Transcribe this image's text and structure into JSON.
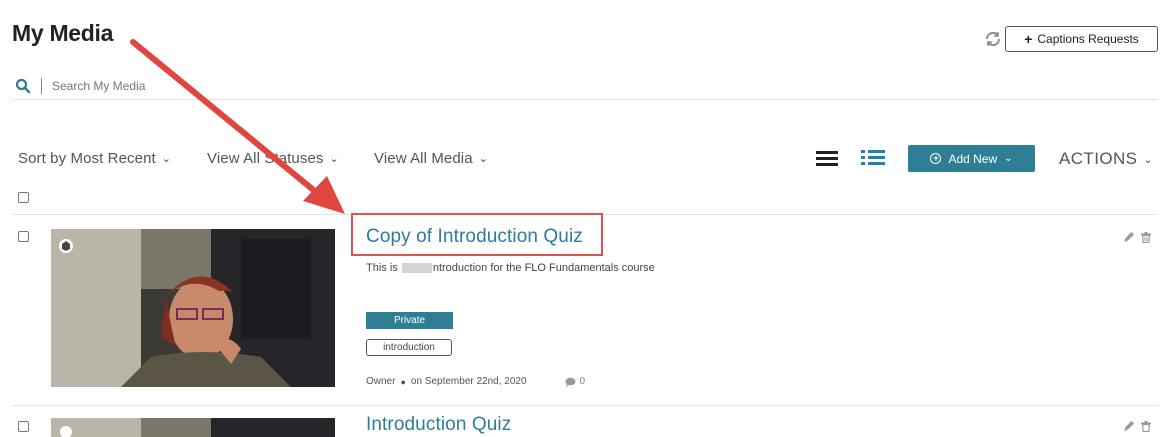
{
  "page": {
    "title": "My Media"
  },
  "header": {
    "refresh_icon": "refresh-icon",
    "captions_button": "Captions Requests"
  },
  "search": {
    "placeholder": "Search My Media"
  },
  "toolbar": {
    "sort_label": "Sort by Most Recent",
    "status_label": "View All Statuses",
    "media_label": "View All Media",
    "add_new_label": "Add New",
    "actions_label": "ACTIONS"
  },
  "media_items": [
    {
      "title": "Copy of Introduction Quiz",
      "description_start": "This is",
      "description_end": "ntroduction for the FLO Fundamentals course",
      "status": "Private",
      "tag": "introduction",
      "owner": "Owner",
      "date": "on September 22nd, 2020",
      "comments": "0"
    },
    {
      "title": "Introduction Quiz"
    }
  ],
  "colors": {
    "accent": "#2e7f95",
    "link": "#2d7d9a",
    "annotation": "#d9534f"
  }
}
